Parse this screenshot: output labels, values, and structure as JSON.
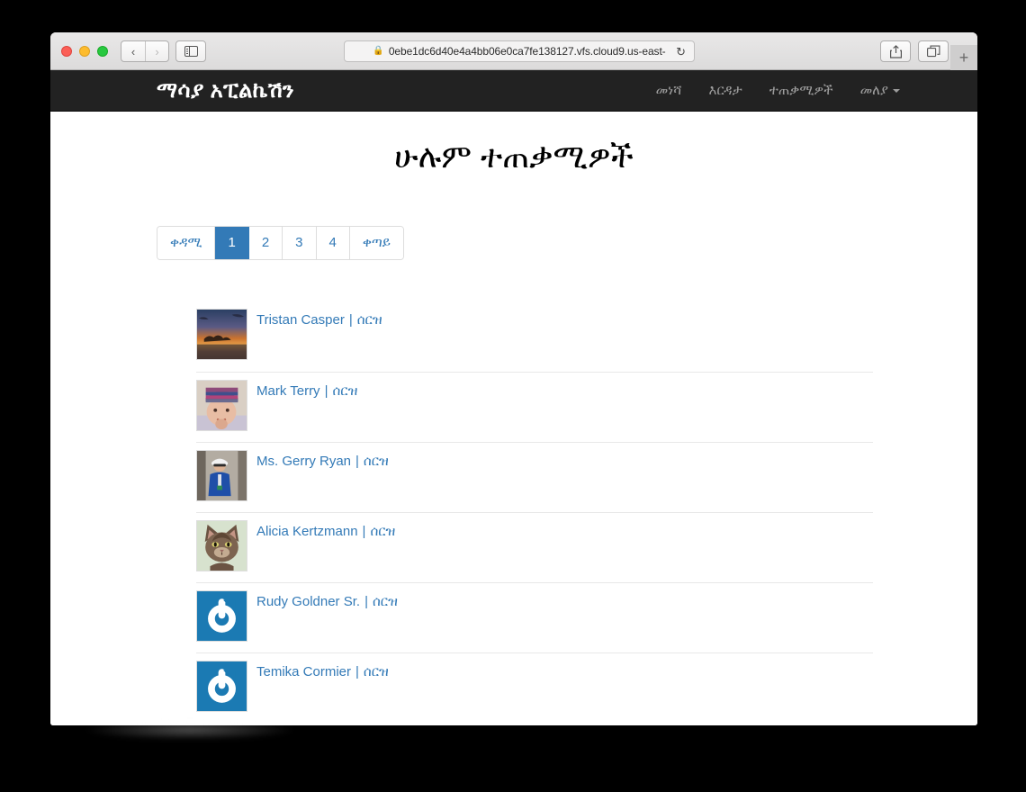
{
  "browser": {
    "traffic_lights": [
      "close",
      "minimize",
      "maximize"
    ],
    "back_label": "‹",
    "forward_label": "›",
    "sidebar_icon": "sidebar-icon",
    "lock_icon": "🔒",
    "url": "0ebe1dc6d40e4a4bb06e0ca7fe138127.vfs.cloud9.us-east-",
    "reload_label": "↻",
    "share_icon": "share-icon",
    "tabs_icon": "show-all-tabs-icon",
    "new_tab_label": "+"
  },
  "navbar": {
    "brand": "ማሳያ አፒልኬሽን",
    "links": [
      {
        "label": "መነሻ",
        "name": "nav-home"
      },
      {
        "label": "እርዳታ",
        "name": "nav-help"
      },
      {
        "label": "ተጠቃሚዎች",
        "name": "nav-users"
      },
      {
        "label": "መለያ",
        "name": "nav-account",
        "caret": true
      }
    ]
  },
  "page": {
    "title": "ሁሉም ተጠቃሚዎች"
  },
  "pagination": {
    "prev_label": "ቀዳሚ",
    "next_label": "ቀጣይ",
    "pages": [
      "1",
      "2",
      "3",
      "4"
    ],
    "active_page": "1",
    "active_color": "#337ab7",
    "link_color": "#337ab7"
  },
  "users": {
    "delete_label": "ሰርዝ",
    "separator": "|",
    "rows": [
      {
        "name": "Tristan Casper",
        "avatar": "sunset-landscape-photo"
      },
      {
        "name": "Mark Terry",
        "avatar": "baby-in-knit-hat-photo"
      },
      {
        "name": "Ms. Gerry Ryan",
        "avatar": "man-in-blue-shirt-photo"
      },
      {
        "name": "Alicia Kertzmann",
        "avatar": "tabby-cat-photo"
      },
      {
        "name": "Rudy Goldner Sr.",
        "avatar": "gravatar-default-logo"
      },
      {
        "name": "Temika Cormier",
        "avatar": "gravatar-default-logo"
      }
    ]
  },
  "colors": {
    "navbar_bg": "#222222",
    "link_blue": "#337ab7",
    "gravatar_blue": "#1b7ab3",
    "page_bg": "#ffffff",
    "desk_bg": "#000000"
  }
}
